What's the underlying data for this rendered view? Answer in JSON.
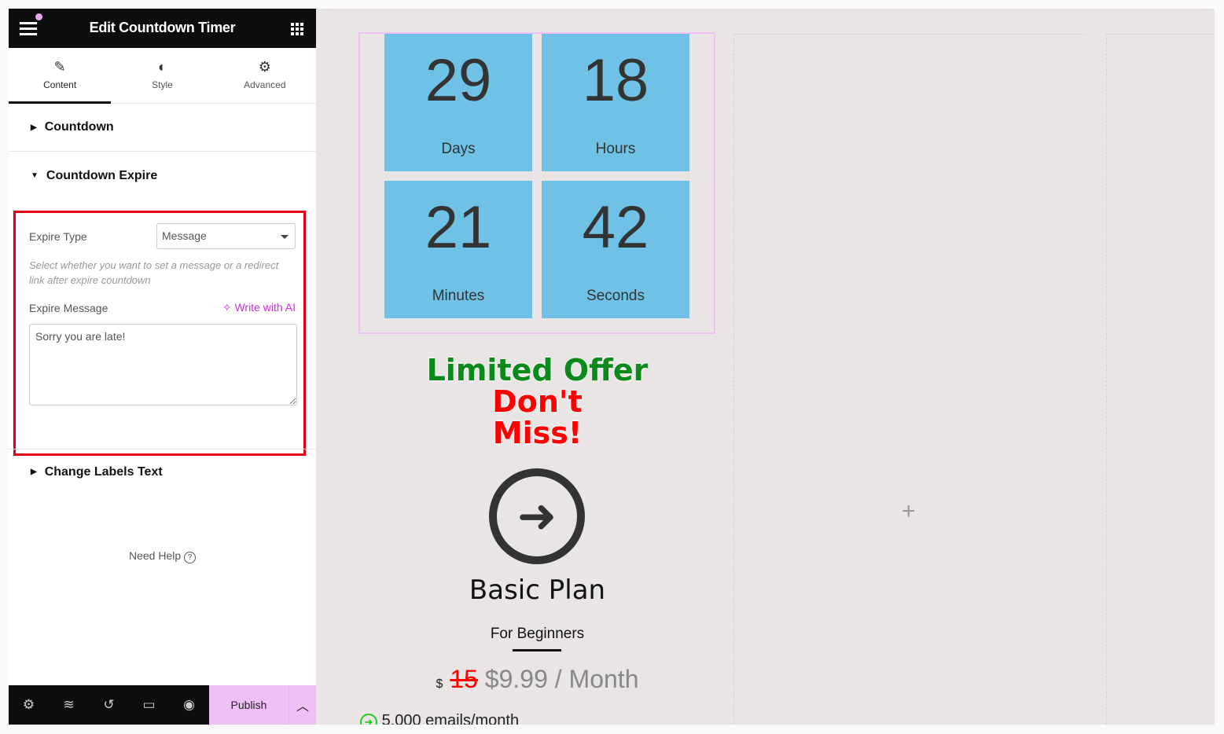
{
  "header": {
    "title": "Edit Countdown Timer"
  },
  "tabs": [
    {
      "label": "Content",
      "icon": "pencil-icon"
    },
    {
      "label": "Style",
      "icon": "half-circle-icon"
    },
    {
      "label": "Advanced",
      "icon": "gear-icon"
    }
  ],
  "sections": {
    "countdown": "Countdown",
    "expire": "Countdown Expire",
    "labels": "Change Labels Text"
  },
  "expire": {
    "type_label": "Expire Type",
    "type_value": "Message",
    "description": "Select whether you want to set a message or a redirect link after expire countdown",
    "message_label": "Expire Message",
    "ai_label": "Write with AI",
    "message_value": "Sorry you are late!"
  },
  "help": "Need Help",
  "footer": {
    "publish": "Publish"
  },
  "timer": [
    {
      "n": "29",
      "l": "Days"
    },
    {
      "n": "18",
      "l": "Hours"
    },
    {
      "n": "21",
      "l": "Minutes"
    },
    {
      "n": "42",
      "l": "Seconds"
    }
  ],
  "offer": {
    "line1": "Limited Offer",
    "line2": "Don't",
    "line3": "Miss!",
    "green": "#0a8a1a",
    "red": "#ff0000"
  },
  "plan": {
    "title": "Basic Plan",
    "subtitle": "For Beginners",
    "currency": "$",
    "old_price": "15",
    "price": "$9.99 / Month",
    "feature": "5,000 emails/month"
  },
  "colors": {
    "accent": "#f0bff7",
    "timer_bg": "#6fc2e6",
    "highlight": "#e00015"
  }
}
